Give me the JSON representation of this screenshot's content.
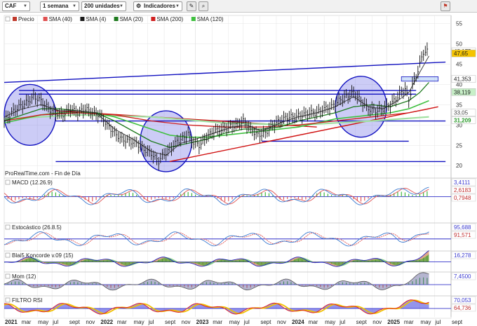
{
  "toolbar": {
    "symbol": "CAF",
    "timeframe": "1 semana",
    "units": "200 unidades",
    "indicators_label": "Indicadores"
  },
  "main_legend": [
    {
      "label": "Precio",
      "color": "#c0392b"
    },
    {
      "label": "SMA (40)",
      "color": "#e05050"
    },
    {
      "label": "SMA (4)",
      "color": "#1a1a1a"
    },
    {
      "label": "SMA (20)",
      "color": "#1e7a1e"
    },
    {
      "label": "SMA (200)",
      "color": "#d02020"
    },
    {
      "label": "SMA (120)",
      "color": "#40c040"
    }
  ],
  "source_note": "ProRealTime.com - Fin de Día",
  "price_axis": {
    "ticks": [
      55,
      50,
      45,
      40,
      35,
      30,
      25,
      20
    ],
    "tags": [
      {
        "value": 48.175,
        "label": "48,175",
        "bg": "#ffffff",
        "fg": "#222222"
      },
      {
        "value": 47.65,
        "label": "47,65",
        "bg": "#f5c400",
        "fg": "#222222"
      },
      {
        "value": 41.353,
        "label": "41,353",
        "bg": "#ffffff",
        "fg": "#222222"
      },
      {
        "value": 38.119,
        "label": "38,119",
        "bg": "#c8f0c8",
        "fg": "#222222"
      },
      {
        "value": 33.05,
        "label": "33,05",
        "bg": "#ffffff",
        "fg": "#444444"
      },
      {
        "value": 31.209,
        "label": "31,209",
        "bg": "#ffffff",
        "fg": "#2a9a2a"
      }
    ]
  },
  "panels": {
    "macd": {
      "label": "MACD (12.26.9)",
      "values": [
        "3,4111",
        "2,6183",
        "0,7948"
      ]
    },
    "stoch": {
      "label": "Estocástico (26.8.5)",
      "values": [
        "95,688",
        "91,571"
      ]
    },
    "koncorde": {
      "label": "Blai5 Koncorde v.09 (15)",
      "values": [
        "16,278"
      ]
    },
    "mom": {
      "label": "Mom (12)",
      "values": [
        "7,4500"
      ]
    },
    "rsi": {
      "label": "FILTRO RSI",
      "values": [
        "70,053",
        "64,736"
      ]
    }
  },
  "time_axis": [
    {
      "label": "2021",
      "bold": true,
      "week": 0
    },
    {
      "label": "mar",
      "week": 9
    },
    {
      "label": "may",
      "week": 18
    },
    {
      "label": "jul",
      "week": 26
    },
    {
      "label": "sept",
      "week": 35
    },
    {
      "label": "nov",
      "week": 44
    },
    {
      "label": "2022",
      "bold": true,
      "week": 52
    },
    {
      "label": "mar",
      "week": 61
    },
    {
      "label": "may",
      "week": 70
    },
    {
      "label": "jul",
      "week": 78
    },
    {
      "label": "sept",
      "week": 87
    },
    {
      "label": "nov",
      "week": 96
    },
    {
      "label": "2023",
      "bold": true,
      "week": 104
    },
    {
      "label": "mar",
      "week": 113
    },
    {
      "label": "may",
      "week": 122
    },
    {
      "label": "jul",
      "week": 130
    },
    {
      "label": "sept",
      "week": 139
    },
    {
      "label": "nov",
      "week": 148
    },
    {
      "label": "2024",
      "bold": true,
      "week": 156
    },
    {
      "label": "mar",
      "week": 165
    },
    {
      "label": "may",
      "week": 174
    },
    {
      "label": "jul",
      "week": 182
    },
    {
      "label": "sept",
      "week": 191
    },
    {
      "label": "nov",
      "week": 200
    },
    {
      "label": "2025",
      "bold": true,
      "week": 208
    },
    {
      "label": "mar",
      "week": 217
    },
    {
      "label": "may",
      "week": 226
    },
    {
      "label": "jul",
      "week": 234
    },
    {
      "label": "sept",
      "week": 243
    }
  ],
  "chart_data": {
    "type": "line",
    "x_unit": "week",
    "price_close": [
      [
        0,
        31
      ],
      [
        4,
        33
      ],
      [
        8,
        34.5
      ],
      [
        12,
        35.5
      ],
      [
        16,
        37
      ],
      [
        20,
        36
      ],
      [
        24,
        34
      ],
      [
        28,
        33
      ],
      [
        32,
        32.5
      ],
      [
        36,
        34
      ],
      [
        40,
        33
      ],
      [
        44,
        34
      ],
      [
        48,
        33
      ],
      [
        52,
        32.5
      ],
      [
        56,
        30
      ],
      [
        60,
        28
      ],
      [
        64,
        26.5
      ],
      [
        68,
        26
      ],
      [
        72,
        25.5
      ],
      [
        76,
        24
      ],
      [
        80,
        23
      ],
      [
        84,
        21
      ],
      [
        86,
        22.5
      ],
      [
        90,
        24
      ],
      [
        94,
        26
      ],
      [
        98,
        27
      ],
      [
        100,
        28
      ],
      [
        102,
        26
      ],
      [
        106,
        25
      ],
      [
        110,
        27
      ],
      [
        114,
        28.5
      ],
      [
        118,
        29
      ],
      [
        122,
        29.5
      ],
      [
        126,
        30
      ],
      [
        130,
        31
      ],
      [
        134,
        29
      ],
      [
        138,
        27.5
      ],
      [
        142,
        28
      ],
      [
        146,
        30
      ],
      [
        150,
        31
      ],
      [
        154,
        32
      ],
      [
        158,
        32
      ],
      [
        162,
        32.5
      ],
      [
        166,
        33
      ],
      [
        170,
        33
      ],
      [
        174,
        34
      ],
      [
        178,
        34.5
      ],
      [
        182,
        36
      ],
      [
        186,
        37
      ],
      [
        190,
        38
      ],
      [
        194,
        36
      ],
      [
        198,
        34
      ],
      [
        202,
        33.5
      ],
      [
        206,
        34
      ],
      [
        210,
        35
      ],
      [
        214,
        37
      ],
      [
        218,
        39
      ],
      [
        220,
        36
      ],
      [
        222,
        40
      ],
      [
        224,
        42
      ],
      [
        226,
        45
      ],
      [
        228,
        48
      ],
      [
        231,
        48.175
      ]
    ],
    "sma_fast": [
      [
        0,
        32
      ],
      [
        10,
        34
      ],
      [
        20,
        35
      ],
      [
        30,
        33.5
      ],
      [
        40,
        33.5
      ],
      [
        50,
        33
      ],
      [
        60,
        29
      ],
      [
        70,
        26.5
      ],
      [
        80,
        23.5
      ],
      [
        88,
        22.5
      ],
      [
        96,
        25.5
      ],
      [
        104,
        26.5
      ],
      [
        114,
        28
      ],
      [
        124,
        29.5
      ],
      [
        132,
        30
      ],
      [
        140,
        28.5
      ],
      [
        150,
        30.5
      ],
      [
        160,
        32
      ],
      [
        170,
        33
      ],
      [
        180,
        34.5
      ],
      [
        190,
        37
      ],
      [
        198,
        34.5
      ],
      [
        206,
        34
      ],
      [
        214,
        36
      ],
      [
        220,
        38
      ],
      [
        226,
        43
      ],
      [
        231,
        47
      ]
    ],
    "sma_mid": [
      [
        0,
        31
      ],
      [
        10,
        32.5
      ],
      [
        20,
        34
      ],
      [
        30,
        34
      ],
      [
        40,
        33.5
      ],
      [
        50,
        33
      ],
      [
        60,
        31
      ],
      [
        70,
        28.5
      ],
      [
        80,
        26
      ],
      [
        90,
        24.5
      ],
      [
        100,
        25.5
      ],
      [
        110,
        26.5
      ],
      [
        120,
        28
      ],
      [
        130,
        29
      ],
      [
        140,
        29
      ],
      [
        150,
        29.5
      ],
      [
        160,
        31
      ],
      [
        170,
        32
      ],
      [
        180,
        33
      ],
      [
        190,
        34.5
      ],
      [
        200,
        35
      ],
      [
        210,
        34.5
      ],
      [
        220,
        36
      ],
      [
        226,
        38
      ],
      [
        231,
        40.5
      ]
    ],
    "sma_slow_green": [
      [
        0,
        30.5
      ],
      [
        10,
        31.5
      ],
      [
        20,
        32.5
      ],
      [
        30,
        33
      ],
      [
        40,
        33
      ],
      [
        50,
        33
      ],
      [
        60,
        32
      ],
      [
        70,
        30.5
      ],
      [
        80,
        29
      ],
      [
        90,
        27.5
      ],
      [
        100,
        27
      ],
      [
        110,
        27
      ],
      [
        120,
        27.5
      ],
      [
        130,
        28
      ],
      [
        140,
        28.5
      ],
      [
        150,
        29
      ],
      [
        160,
        29.5
      ],
      [
        170,
        30.5
      ],
      [
        180,
        31.5
      ],
      [
        190,
        32
      ],
      [
        200,
        32.5
      ],
      [
        210,
        33
      ],
      [
        220,
        34
      ],
      [
        231,
        36
      ]
    ],
    "sma_long_red": [
      [
        0,
        31
      ],
      [
        20,
        32.5
      ],
      [
        40,
        33
      ],
      [
        60,
        32.5
      ],
      [
        80,
        31
      ],
      [
        100,
        30
      ],
      [
        120,
        29.5
      ],
      [
        140,
        29.5
      ],
      [
        160,
        30
      ],
      [
        180,
        31
      ],
      [
        200,
        32
      ],
      [
        220,
        33
      ],
      [
        231,
        34
      ]
    ],
    "sma_longest": [
      [
        0,
        31.5
      ],
      [
        40,
        32.5
      ],
      [
        80,
        32
      ],
      [
        120,
        30.5
      ],
      [
        160,
        30
      ],
      [
        200,
        31
      ],
      [
        231,
        32
      ]
    ],
    "drawn_lines": [
      {
        "from": [
          0,
          40.5
        ],
        "to": [
          240,
          45.5
        ],
        "color": "#1010c0"
      },
      {
        "from": [
          8,
          38.5
        ],
        "to": [
          224,
          38.5
        ],
        "color": "#1010c0"
      },
      {
        "from": [
          8,
          37.6
        ],
        "to": [
          224,
          37.6
        ],
        "color": "#1010c0"
      },
      {
        "from": [
          28,
          31
        ],
        "to": [
          240,
          31
        ],
        "color": "#1010c0"
      },
      {
        "from": [
          28,
          21
        ],
        "to": [
          240,
          21
        ],
        "color": "#1010c0"
      },
      {
        "from": [
          140,
          26
        ],
        "to": [
          220,
          26
        ],
        "color": "#1010c0"
      },
      {
        "from": [
          90,
          21
        ],
        "to": [
          236,
          34.5
        ],
        "color": "#d01010"
      },
      {
        "from": [
          28,
          33.5
        ],
        "to": [
          170,
          29.5
        ],
        "color": "#d01010"
      }
    ],
    "circles": [
      {
        "cx": 14,
        "cy": 32.5,
        "rx": 14,
        "ry": 7.5
      },
      {
        "cx": 88,
        "cy": 26,
        "rx": 14,
        "ry": 7.5
      },
      {
        "cx": 194,
        "cy": 34.5,
        "rx": 14,
        "ry": 7.5
      }
    ],
    "xlim": [
      0,
      243
    ],
    "ylim": [
      19,
      57
    ]
  },
  "colors": {
    "grid": "#e4e4e4",
    "axis": "#888888",
    "accent": "#1010c0"
  }
}
